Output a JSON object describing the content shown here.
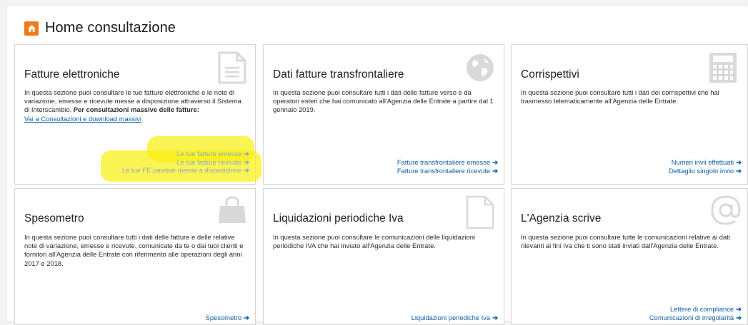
{
  "header": {
    "title": "Home consultazione",
    "icon": "home-icon"
  },
  "cards": {
    "fatture": {
      "title": "Fatture elettroniche",
      "desc": "In questa sezione puoi consultare le tue fatture elettroniche e le note di variazione, emesse e ricevute messe a disposizione attraverso il Sistema di Interscambio.",
      "bold": "Per consultazioni massive delle fatture:",
      "inline_link": "Vai a Consultazioni e download massivi",
      "links": [
        "Le tue fatture emesse",
        "Le tue fatture ricevute",
        "Le tue FE passive messe a disposizione"
      ],
      "icon": "document-icon"
    },
    "transfrontaliere": {
      "title": "Dati fatture transfrontaliere",
      "desc": "In questa sezione puoi consultare tutti i dati delle fatture verso e da operatori esteri che hai comunicato all'Agenzia delle Entrate a partire dal 1 gennaio 2019.",
      "links": [
        "Fatture transfrontaliere emesse",
        "Fatture transfrontaliere ricevute"
      ],
      "icon": "globe-icon"
    },
    "corrispettivi": {
      "title": "Corrispettivi",
      "desc": "In questa sezione puoi consultare tutti i dati dei corrispettivi che hai trasmesso telematicamente all'Agenzia delle Entrate.",
      "links": [
        "Numeri invii effettuati",
        "Dettaglio singolo invio"
      ],
      "icon": "calculator-icon"
    },
    "spesometro": {
      "title": "Spesometro",
      "desc": "In questa sezione puoi consultare tutti i dati delle fatture e delle relative note di variazione, emesse e ricevute, comunicate da te o dai tuoi clienti e fornitori all'Agenzia delle Entrate con riferimento alle operazioni degli anni 2017 e 2018.",
      "links": [
        "Spesometro"
      ],
      "icon": "shopping-bag-icon"
    },
    "liquidazioni": {
      "title": "Liquidazioni periodiche Iva",
      "desc": "In questa sezione puoi consultare le comunicazioni delle liquidazioni periodiche IVA che hai inviato all'Agenzia delle Entrate.",
      "links": [
        "Liquidazioni periodiche Iva"
      ],
      "icon": "blank-document-icon"
    },
    "agenzia": {
      "title": "L'Agenzia scrive",
      "desc": "In questa sezione puoi consultare tutte le comunicazioni relative ai dati rilevanti ai fini Iva che ti sono stati inviati dall'Agenzia delle Entrate.",
      "links": [
        "Lettere di compliance",
        "Comunicazioni di irregolarità"
      ],
      "icon": "at-sign-icon"
    }
  },
  "arrow": "➔",
  "colors": {
    "accent": "#f07a1a",
    "link": "#0b5ea8",
    "highlight": "#faf014",
    "icon": "#d9d9d9"
  }
}
